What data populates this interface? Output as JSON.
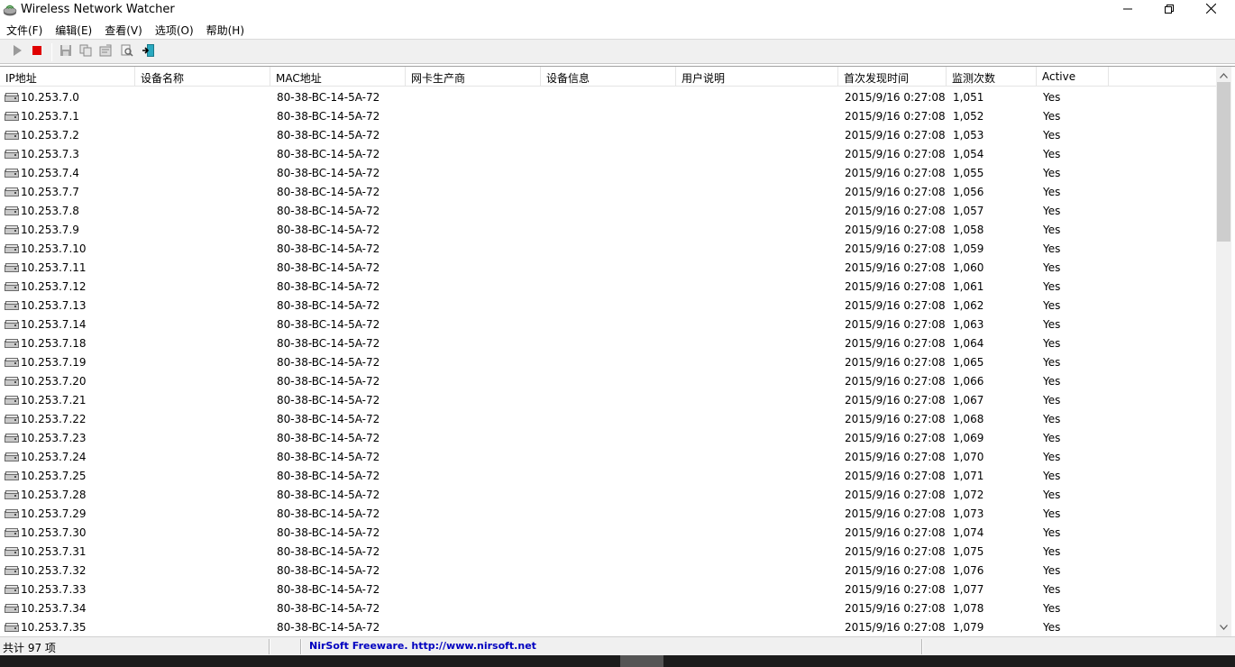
{
  "window": {
    "title": "Wireless Network Watcher"
  },
  "menu": [
    "文件(F)",
    "编辑(E)",
    "查看(V)",
    "选项(O)",
    "帮助(H)"
  ],
  "toolbar": [
    {
      "name": "start-icon"
    },
    {
      "name": "stop-icon",
      "color": "#e00000"
    },
    {
      "name": "save-icon"
    },
    {
      "name": "copy-icon"
    },
    {
      "name": "properties-icon"
    },
    {
      "name": "search-icon"
    },
    {
      "name": "exit-icon"
    }
  ],
  "columns": [
    "IP地址",
    "设备名称",
    "MAC地址",
    "网卡生产商",
    "设备信息",
    "用户说明",
    "首次发现时间",
    "监测次数",
    "Active"
  ],
  "rows": [
    {
      "ip": "10.253.7.0",
      "mac": "80-38-BC-14-5A-72",
      "first": "2015/9/16 0:27:08",
      "count": "1,051",
      "active": "Yes"
    },
    {
      "ip": "10.253.7.1",
      "mac": "80-38-BC-14-5A-72",
      "first": "2015/9/16 0:27:08",
      "count": "1,052",
      "active": "Yes"
    },
    {
      "ip": "10.253.7.2",
      "mac": "80-38-BC-14-5A-72",
      "first": "2015/9/16 0:27:08",
      "count": "1,053",
      "active": "Yes"
    },
    {
      "ip": "10.253.7.3",
      "mac": "80-38-BC-14-5A-72",
      "first": "2015/9/16 0:27:08",
      "count": "1,054",
      "active": "Yes"
    },
    {
      "ip": "10.253.7.4",
      "mac": "80-38-BC-14-5A-72",
      "first": "2015/9/16 0:27:08",
      "count": "1,055",
      "active": "Yes"
    },
    {
      "ip": "10.253.7.7",
      "mac": "80-38-BC-14-5A-72",
      "first": "2015/9/16 0:27:08",
      "count": "1,056",
      "active": "Yes"
    },
    {
      "ip": "10.253.7.8",
      "mac": "80-38-BC-14-5A-72",
      "first": "2015/9/16 0:27:08",
      "count": "1,057",
      "active": "Yes"
    },
    {
      "ip": "10.253.7.9",
      "mac": "80-38-BC-14-5A-72",
      "first": "2015/9/16 0:27:08",
      "count": "1,058",
      "active": "Yes"
    },
    {
      "ip": "10.253.7.10",
      "mac": "80-38-BC-14-5A-72",
      "first": "2015/9/16 0:27:08",
      "count": "1,059",
      "active": "Yes"
    },
    {
      "ip": "10.253.7.11",
      "mac": "80-38-BC-14-5A-72",
      "first": "2015/9/16 0:27:08",
      "count": "1,060",
      "active": "Yes"
    },
    {
      "ip": "10.253.7.12",
      "mac": "80-38-BC-14-5A-72",
      "first": "2015/9/16 0:27:08",
      "count": "1,061",
      "active": "Yes"
    },
    {
      "ip": "10.253.7.13",
      "mac": "80-38-BC-14-5A-72",
      "first": "2015/9/16 0:27:08",
      "count": "1,062",
      "active": "Yes"
    },
    {
      "ip": "10.253.7.14",
      "mac": "80-38-BC-14-5A-72",
      "first": "2015/9/16 0:27:08",
      "count": "1,063",
      "active": "Yes"
    },
    {
      "ip": "10.253.7.18",
      "mac": "80-38-BC-14-5A-72",
      "first": "2015/9/16 0:27:08",
      "count": "1,064",
      "active": "Yes"
    },
    {
      "ip": "10.253.7.19",
      "mac": "80-38-BC-14-5A-72",
      "first": "2015/9/16 0:27:08",
      "count": "1,065",
      "active": "Yes"
    },
    {
      "ip": "10.253.7.20",
      "mac": "80-38-BC-14-5A-72",
      "first": "2015/9/16 0:27:08",
      "count": "1,066",
      "active": "Yes"
    },
    {
      "ip": "10.253.7.21",
      "mac": "80-38-BC-14-5A-72",
      "first": "2015/9/16 0:27:08",
      "count": "1,067",
      "active": "Yes"
    },
    {
      "ip": "10.253.7.22",
      "mac": "80-38-BC-14-5A-72",
      "first": "2015/9/16 0:27:08",
      "count": "1,068",
      "active": "Yes"
    },
    {
      "ip": "10.253.7.23",
      "mac": "80-38-BC-14-5A-72",
      "first": "2015/9/16 0:27:08",
      "count": "1,069",
      "active": "Yes"
    },
    {
      "ip": "10.253.7.24",
      "mac": "80-38-BC-14-5A-72",
      "first": "2015/9/16 0:27:08",
      "count": "1,070",
      "active": "Yes"
    },
    {
      "ip": "10.253.7.25",
      "mac": "80-38-BC-14-5A-72",
      "first": "2015/9/16 0:27:08",
      "count": "1,071",
      "active": "Yes"
    },
    {
      "ip": "10.253.7.28",
      "mac": "80-38-BC-14-5A-72",
      "first": "2015/9/16 0:27:08",
      "count": "1,072",
      "active": "Yes"
    },
    {
      "ip": "10.253.7.29",
      "mac": "80-38-BC-14-5A-72",
      "first": "2015/9/16 0:27:08",
      "count": "1,073",
      "active": "Yes"
    },
    {
      "ip": "10.253.7.30",
      "mac": "80-38-BC-14-5A-72",
      "first": "2015/9/16 0:27:08",
      "count": "1,074",
      "active": "Yes"
    },
    {
      "ip": "10.253.7.31",
      "mac": "80-38-BC-14-5A-72",
      "first": "2015/9/16 0:27:08",
      "count": "1,075",
      "active": "Yes"
    },
    {
      "ip": "10.253.7.32",
      "mac": "80-38-BC-14-5A-72",
      "first": "2015/9/16 0:27:08",
      "count": "1,076",
      "active": "Yes"
    },
    {
      "ip": "10.253.7.33",
      "mac": "80-38-BC-14-5A-72",
      "first": "2015/9/16 0:27:08",
      "count": "1,077",
      "active": "Yes"
    },
    {
      "ip": "10.253.7.34",
      "mac": "80-38-BC-14-5A-72",
      "first": "2015/9/16 0:27:08",
      "count": "1,078",
      "active": "Yes"
    },
    {
      "ip": "10.253.7.35",
      "mac": "80-38-BC-14-5A-72",
      "first": "2015/9/16 0:27:08",
      "count": "1,079",
      "active": "Yes"
    }
  ],
  "status": {
    "count": "共计 97 项",
    "link": "NirSoft Freeware.  http://www.nirsoft.net"
  }
}
